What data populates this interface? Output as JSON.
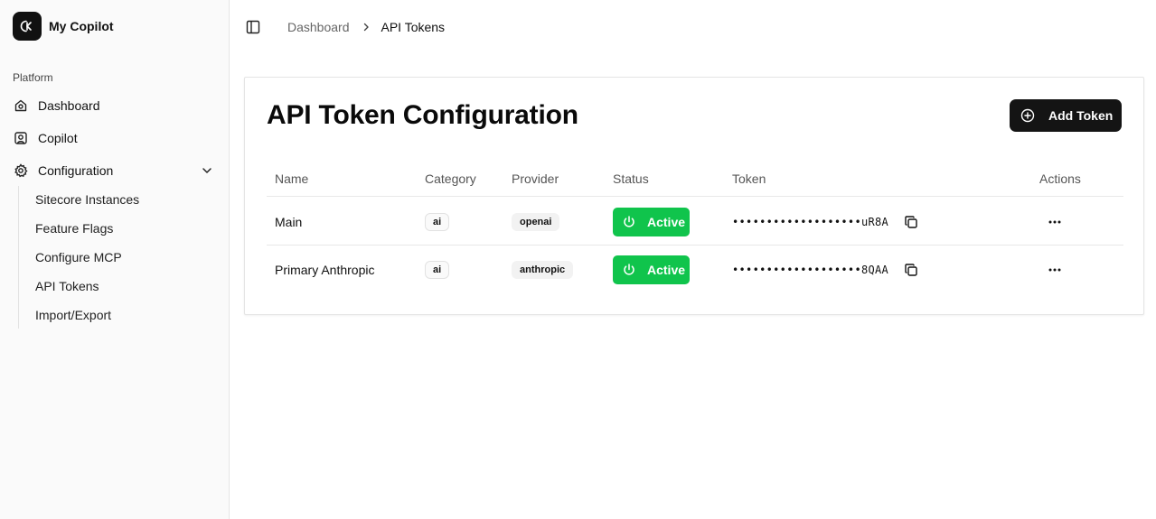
{
  "app": {
    "name": "My Copilot"
  },
  "sidebar": {
    "section_label": "Platform",
    "items": [
      {
        "label": "Dashboard",
        "icon": "home-icon"
      },
      {
        "label": "Copilot",
        "icon": "user-square-icon"
      },
      {
        "label": "Configuration",
        "icon": "gear-icon",
        "expanded": true
      }
    ],
    "sub_items": [
      {
        "label": "Sitecore Instances"
      },
      {
        "label": "Feature Flags"
      },
      {
        "label": "Configure MCP"
      },
      {
        "label": "API Tokens"
      },
      {
        "label": "Import/Export"
      }
    ]
  },
  "breadcrumb": {
    "parent": "Dashboard",
    "current": "API Tokens"
  },
  "main": {
    "title": "API Token Configuration",
    "add_button": "Add Token",
    "columns": [
      "Name",
      "Category",
      "Provider",
      "Status",
      "Token",
      "Actions"
    ],
    "rows": [
      {
        "name": "Main",
        "category": "ai",
        "provider": "openai",
        "status": "Active",
        "token": "•••••••••••••••••••uR8A"
      },
      {
        "name": "Primary Anthropic",
        "category": "ai",
        "provider": "anthropic",
        "status": "Active",
        "token": "•••••••••••••••••••8QAA"
      }
    ]
  },
  "colors": {
    "active": "#10c44c",
    "primary": "#141414"
  }
}
